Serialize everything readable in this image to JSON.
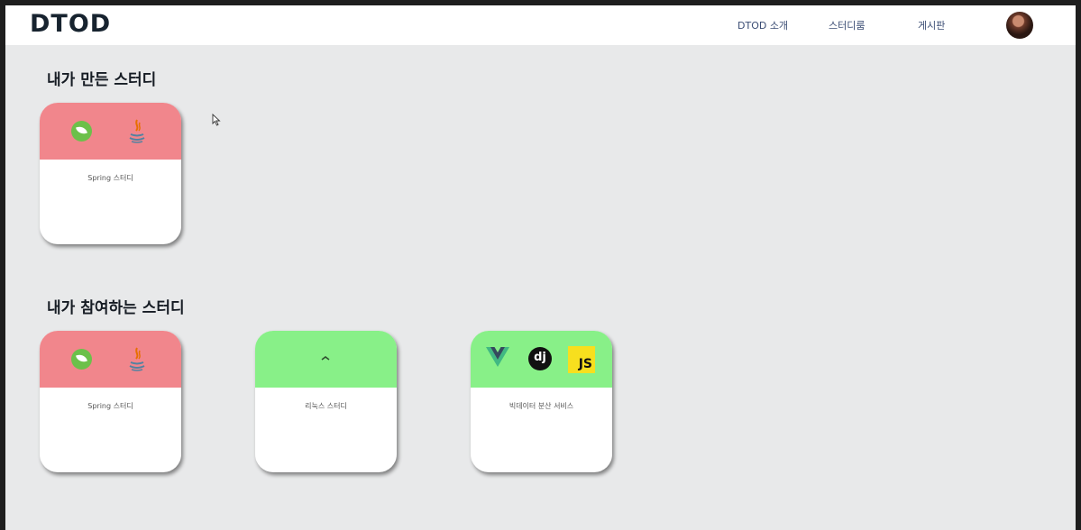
{
  "header": {
    "logo": "DTOD",
    "nav": [
      "DTOD 소개",
      "스터디룸",
      "게시판"
    ]
  },
  "sections": {
    "made_title": "내가 만든 스터디",
    "joined_title": "내가 참여하는 스터디"
  },
  "made_studies": [
    {
      "name": "Spring 스터디",
      "header_color": "#f1868c",
      "icons": [
        "spring-icon",
        "java-icon"
      ]
    }
  ],
  "joined_studies": [
    {
      "name": "Spring 스터디",
      "header_color": "#f1868c",
      "icons": [
        "spring-icon",
        "java-icon"
      ]
    },
    {
      "name": "리눅스 스터디",
      "header_color": "#88f088",
      "icons": [
        "linux-icon"
      ]
    },
    {
      "name": "빅데이터 분산 서비스",
      "header_color": "#88f088",
      "icons": [
        "vue-icon",
        "django-icon",
        "javascript-icon"
      ]
    }
  ],
  "icon_text": {
    "django": "dj",
    "js": "JS"
  },
  "colors": {
    "red_header": "#f1868c",
    "green_header": "#88f088",
    "nav_text": "#3b4d74"
  }
}
